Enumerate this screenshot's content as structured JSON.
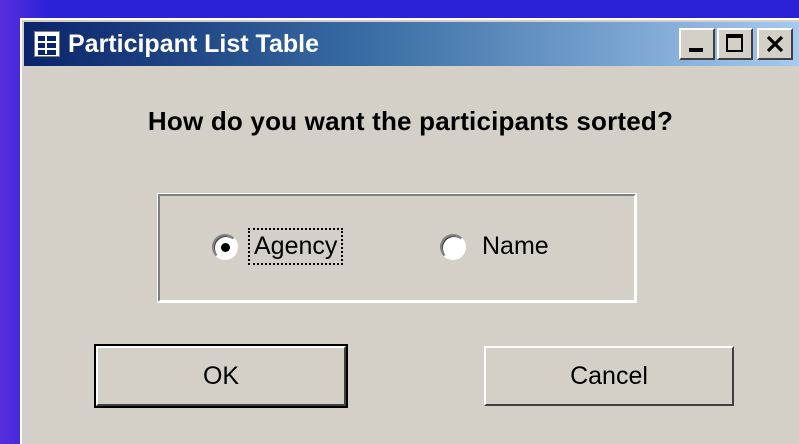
{
  "window": {
    "title": "Participant List Table",
    "icon": "form-icon",
    "controls": {
      "minimize": "minimize-icon",
      "maximize": "maximize-icon",
      "close": "close-icon"
    }
  },
  "dialog": {
    "prompt": "How do you want the participants sorted?",
    "options": [
      {
        "label": "Agency",
        "selected": true
      },
      {
        "label": "Name",
        "selected": false
      }
    ],
    "buttons": {
      "ok_label": "OK",
      "cancel_label": "Cancel"
    }
  },
  "colors": {
    "desktop": "#2b22d8",
    "titlebar_start": "#0a246a",
    "titlebar_end": "#a6caf0",
    "face": "#d4d0c8"
  }
}
